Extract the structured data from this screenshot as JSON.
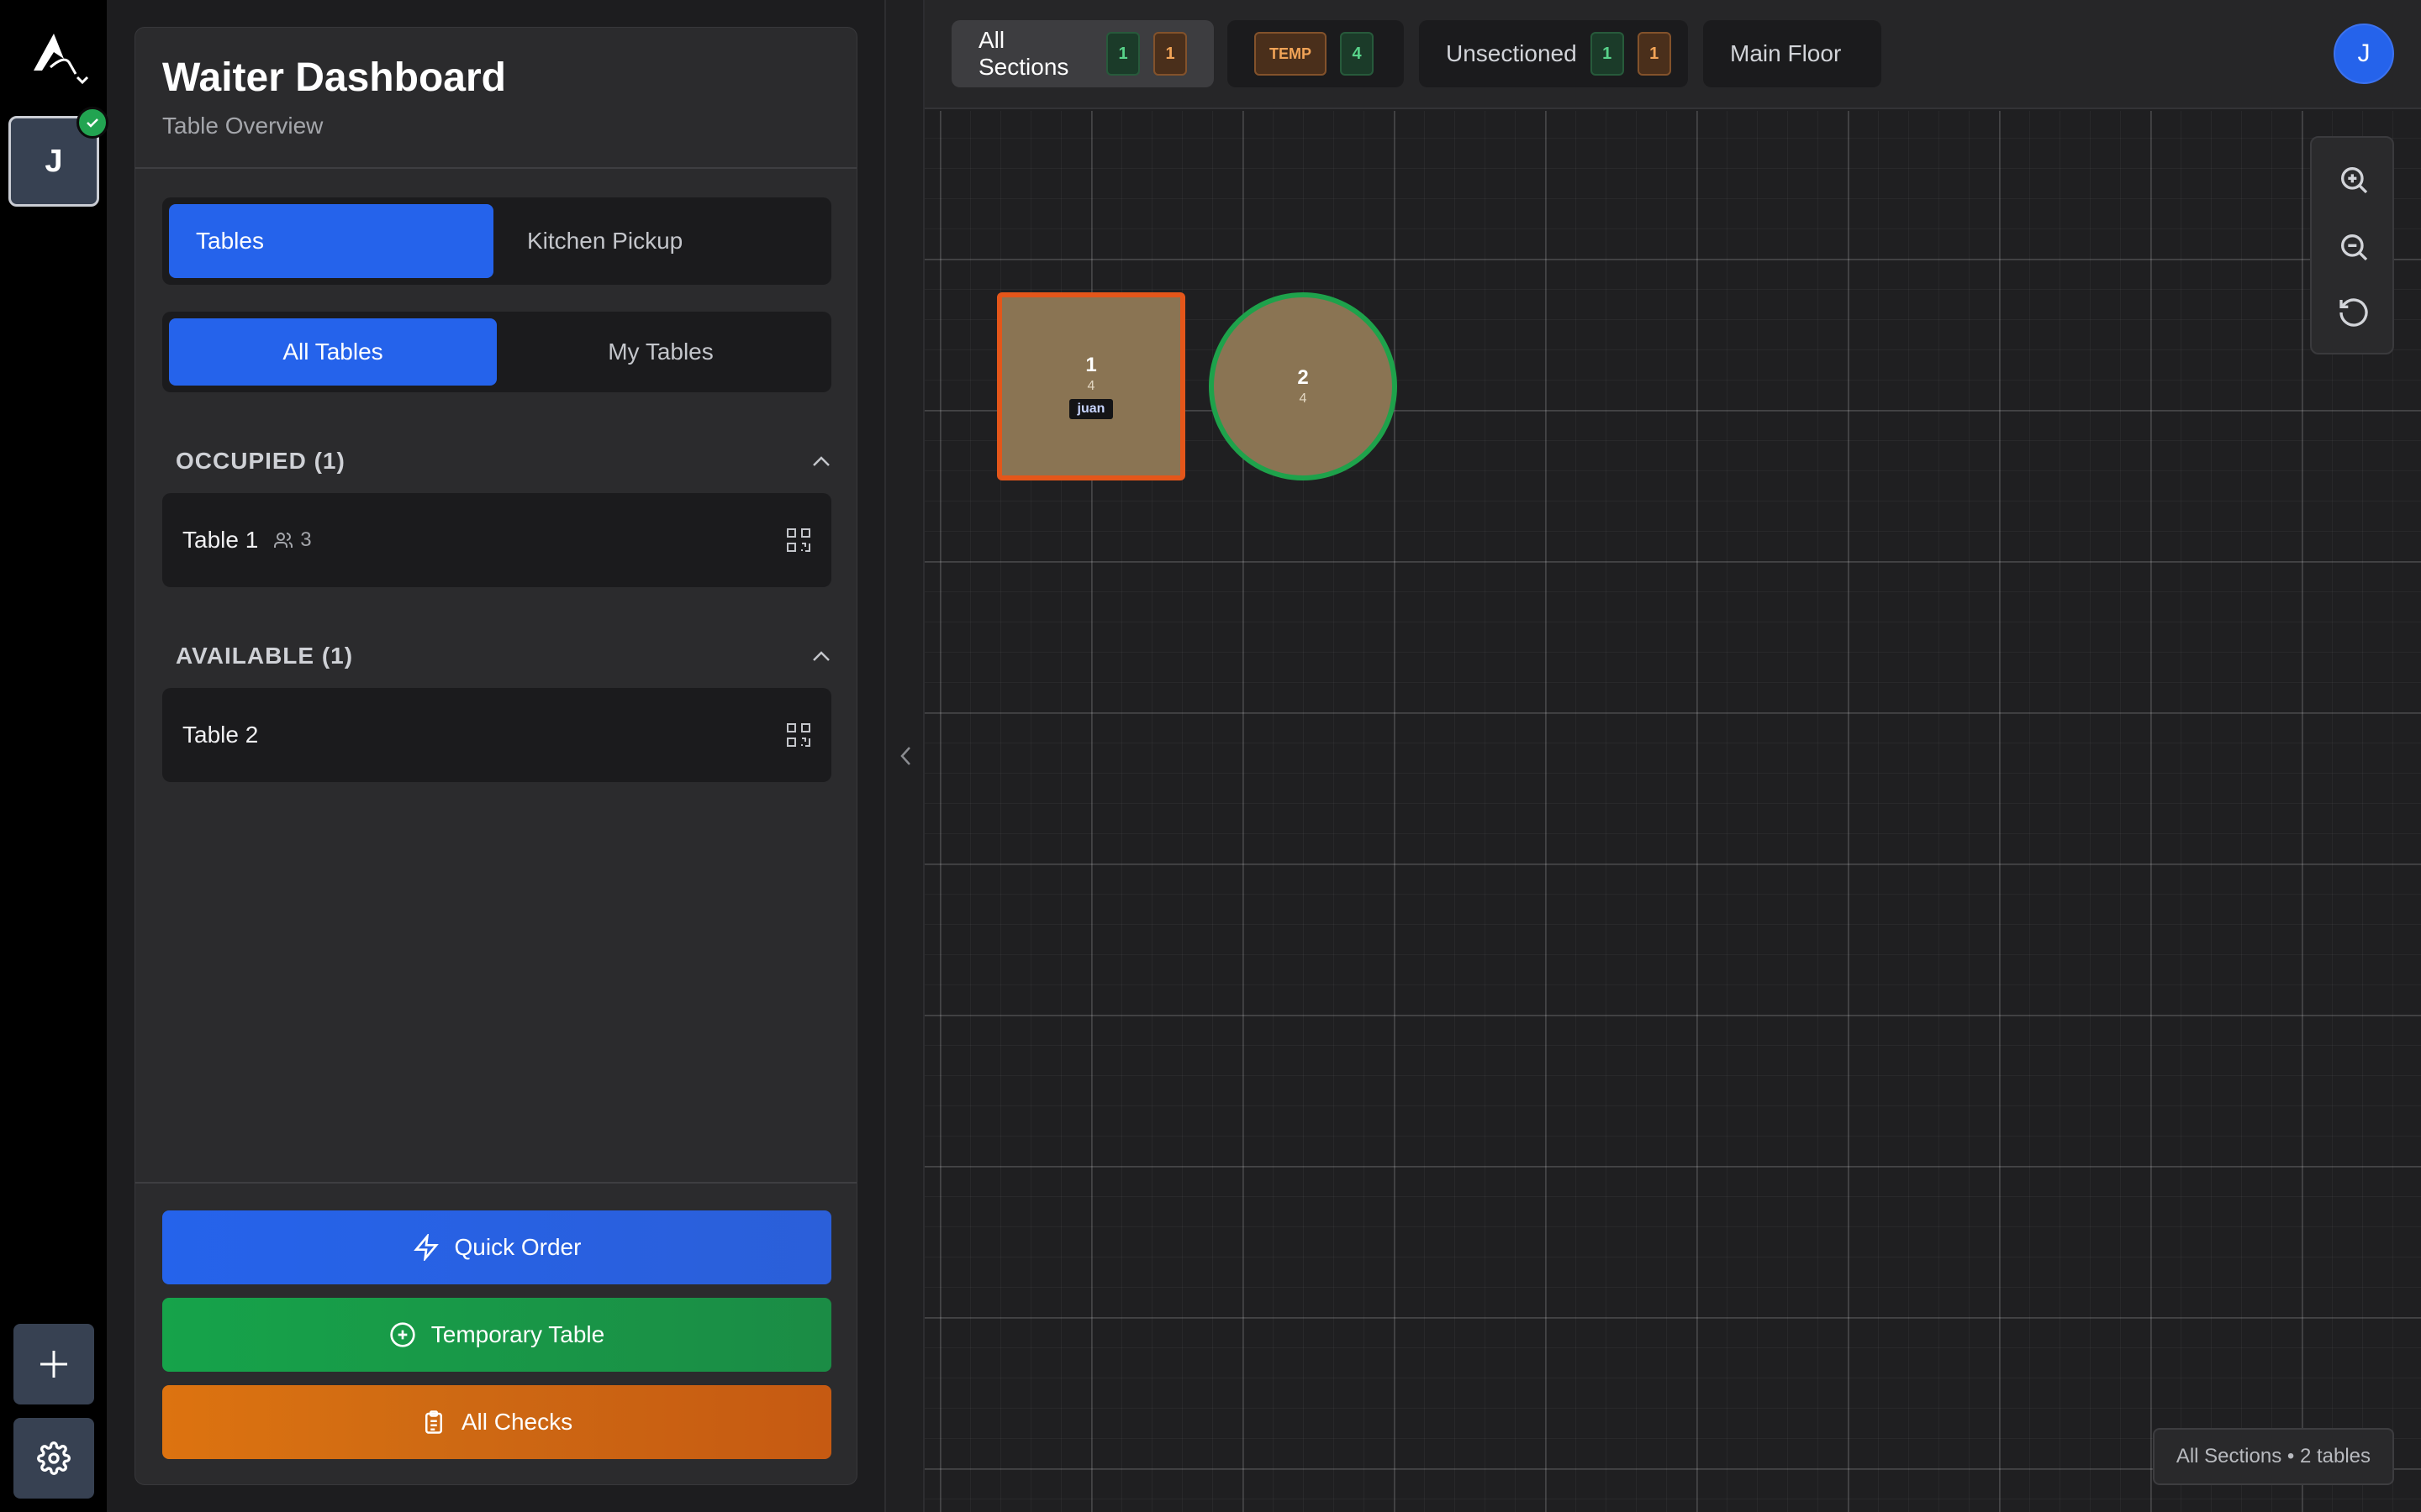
{
  "rail": {
    "user_initial": "J"
  },
  "panel": {
    "title": "Waiter Dashboard",
    "subtitle": "Table Overview",
    "view_tabs": [
      {
        "label": "Tables",
        "active": true
      },
      {
        "label": "Kitchen Pickup",
        "active": false
      }
    ],
    "filter_tabs": [
      {
        "label": "All Tables",
        "active": true
      },
      {
        "label": "My Tables",
        "active": false
      }
    ],
    "groups": [
      {
        "title": "OCCUPIED (1)",
        "rows": [
          {
            "name": "Table 1",
            "guests": "3"
          }
        ]
      },
      {
        "title": "AVAILABLE (1)",
        "rows": [
          {
            "name": "Table 2"
          }
        ]
      }
    ],
    "actions": {
      "quick_order": "Quick Order",
      "temporary_table": "Temporary Table",
      "all_checks": "All Checks"
    }
  },
  "floor": {
    "sections": [
      {
        "label": "All Sections",
        "active": true,
        "badges": [
          {
            "value": "1",
            "color": "green"
          },
          {
            "value": "1",
            "color": "orange"
          }
        ]
      },
      {
        "label": "TEMP",
        "active": false,
        "badges": [
          {
            "value": "4",
            "color": "green"
          }
        ]
      },
      {
        "label": "Unsectioned",
        "active": false,
        "badges": [
          {
            "value": "1",
            "color": "green"
          },
          {
            "value": "1",
            "color": "orange"
          }
        ]
      },
      {
        "label": "Main Floor",
        "active": false,
        "badges": []
      }
    ],
    "user_initial": "J",
    "tables": [
      {
        "number": "1",
        "capacity": "4",
        "server": "juan",
        "shape": "square",
        "status_color": "#e4561a"
      },
      {
        "number": "2",
        "capacity": "4",
        "shape": "circle",
        "status_color": "#1ea24b"
      }
    ],
    "info": "All Sections • 2 tables"
  },
  "colors": {
    "accent": "#2563eb",
    "success": "#16a34a",
    "warning": "#dd7310"
  }
}
